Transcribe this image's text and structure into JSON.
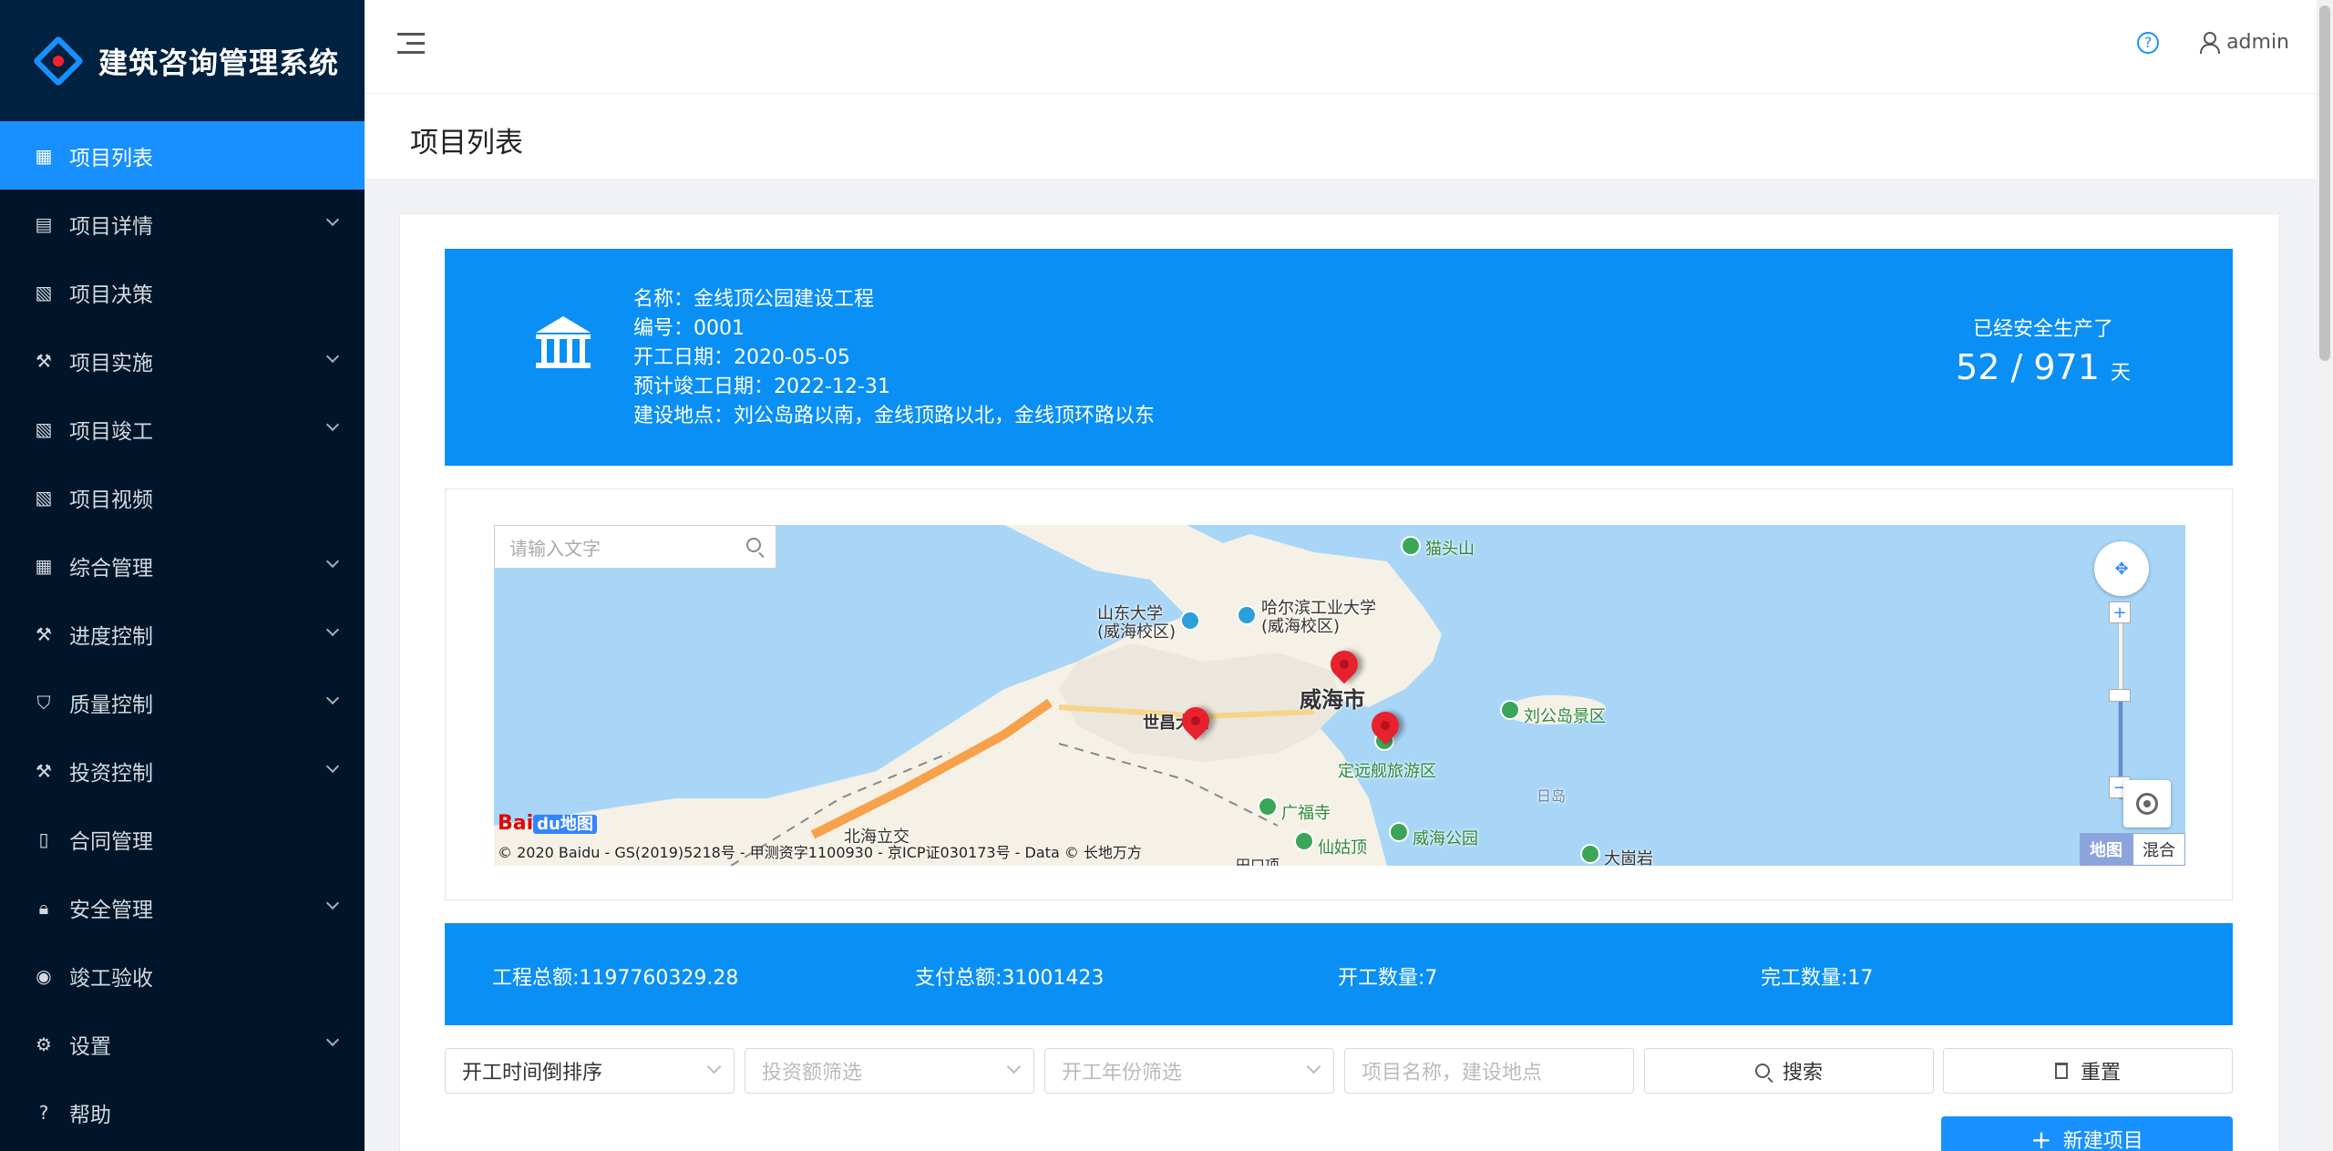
{
  "app": {
    "title": "建筑咨询管理系统"
  },
  "sidebar": {
    "items": [
      {
        "label": "项目列表",
        "icon": "table-icon",
        "active": true,
        "has_children": false
      },
      {
        "label": "项目详情",
        "icon": "profile-icon",
        "active": false,
        "has_children": true
      },
      {
        "label": "项目决策",
        "icon": "audit-icon",
        "active": false,
        "has_children": false
      },
      {
        "label": "项目实施",
        "icon": "tool-icon",
        "active": false,
        "has_children": true
      },
      {
        "label": "项目竣工",
        "icon": "audit-icon",
        "active": false,
        "has_children": true
      },
      {
        "label": "项目视频",
        "icon": "audit-icon",
        "active": false,
        "has_children": false
      },
      {
        "label": "综合管理",
        "icon": "appstore-icon",
        "active": false,
        "has_children": true
      },
      {
        "label": "进度控制",
        "icon": "tool-icon",
        "active": false,
        "has_children": true
      },
      {
        "label": "质量控制",
        "icon": "safety-icon",
        "active": false,
        "has_children": true
      },
      {
        "label": "投资控制",
        "icon": "tool-icon",
        "active": false,
        "has_children": true
      },
      {
        "label": "合同管理",
        "icon": "file-icon",
        "active": false,
        "has_children": false
      },
      {
        "label": "安全管理",
        "icon": "lock-icon",
        "active": false,
        "has_children": true
      },
      {
        "label": "竣工验收",
        "icon": "eye-icon",
        "active": false,
        "has_children": false
      },
      {
        "label": "设置",
        "icon": "setting-icon",
        "active": false,
        "has_children": true
      },
      {
        "label": "帮助",
        "icon": "question-icon",
        "active": false,
        "has_children": false
      }
    ]
  },
  "header": {
    "help": "?",
    "username": "admin"
  },
  "page": {
    "title": "项目列表"
  },
  "project": {
    "name": "名称：金线顶公园建设工程",
    "code": "编号：0001",
    "start_date": "开工日期：2020-05-05",
    "end_date": "预计竣工日期：2022-12-31",
    "location": "建设地点：刘公岛路以南，金线顶路以北，金线顶环路以东",
    "safe_label": "已经安全生产了",
    "safe_value": "52 / 971",
    "safe_unit": "天"
  },
  "map": {
    "search_placeholder": "请输入文字",
    "labels": {
      "maotoushan": "猫头山",
      "shandong_univ": "山东大学\n(威海校区)",
      "hit": "哈尔滨工业大学\n(威海校区)",
      "weihai": "威海市",
      "liugongdao": "刘公岛景区",
      "dingyuan": "定远舰旅游区",
      "shichang": "世昌大道",
      "guangfu": "广福寺",
      "xiangu": "仙姑顶",
      "weihai_park": "威海公园",
      "dashan": "大崮岩",
      "beihai": "北海立交",
      "ridao": "日岛",
      "tiankou": "田口项"
    },
    "copyright": "© 2020 Baidu - GS(2019)5218号 - 甲测资字1100930 - 京ICP证030173号 - Data © 长地万方",
    "logo_text": "Bai",
    "logo_badge": "du地图",
    "type_map": "地图",
    "type_hybrid": "混合",
    "zoom_in": "+",
    "zoom_out": "−"
  },
  "stats": {
    "total_amount": "工程总额:1197760329.28",
    "total_paid": "支付总额:31001423",
    "started": "开工数量:7",
    "completed": "完工数量:17"
  },
  "filters": {
    "sort": "开工时间倒排序",
    "invest": "投资额筛选",
    "year": "开工年份筛选",
    "keyword_placeholder": "项目名称，建设地点",
    "search": "搜索",
    "reset": "重置",
    "new_project": "新建项目"
  },
  "colors": {
    "primary": "#1890ff",
    "sidebar_bg": "#001529",
    "banner_bg": "#0a8ff5"
  }
}
